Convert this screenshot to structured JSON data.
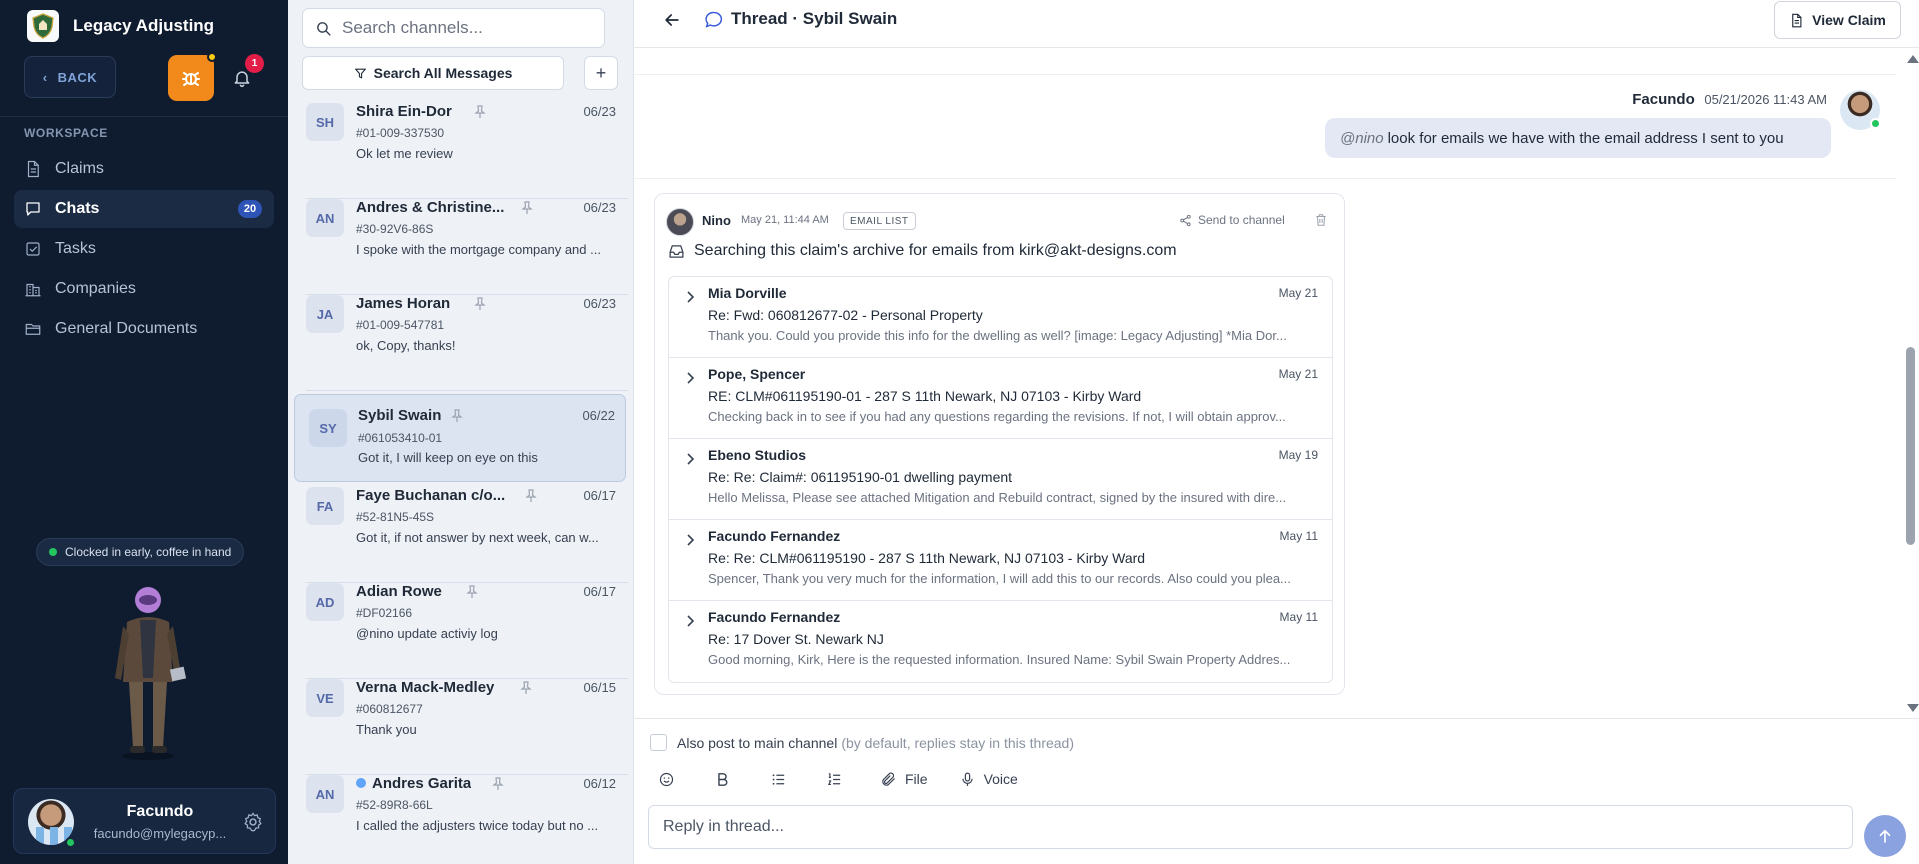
{
  "app": {
    "name": "Legacy Adjusting"
  },
  "sidebar": {
    "back_label": "BACK",
    "notification_count": "1",
    "section_label": "WORKSPACE",
    "items": [
      {
        "label": "Claims",
        "icon": "document-icon"
      },
      {
        "label": "Chats",
        "icon": "chat-icon",
        "badge": "20",
        "active": true
      },
      {
        "label": "Tasks",
        "icon": "checkbox-icon"
      },
      {
        "label": "Companies",
        "icon": "building-icon"
      },
      {
        "label": "General Documents",
        "icon": "folder-icon"
      }
    ],
    "status_text": "Clocked in early, coffee in hand",
    "user": {
      "name": "Facundo",
      "email": "facundo@mylegacyp..."
    }
  },
  "channels": {
    "search_placeholder": "Search channels...",
    "search_all_label": "Search All Messages",
    "add_label": "+",
    "items": [
      {
        "initials": "SH",
        "name": "Shira Ein-Dor",
        "date": "06/23",
        "claim": "#01-009-337530",
        "message": "Ok let me review"
      },
      {
        "initials": "AN",
        "name": "Andres & Christine...",
        "date": "06/23",
        "claim": "#30-92V6-86S",
        "message": "I spoke with the mortgage company and ..."
      },
      {
        "initials": "JA",
        "name": "James Horan",
        "date": "06/23",
        "claim": "#01-009-547781",
        "message": "ok, Copy, thanks!"
      },
      {
        "initials": "SY",
        "name": "Sybil Swain",
        "date": "06/22",
        "claim": "#061053410-01",
        "message": "Got it, I will keep on eye on this",
        "selected": true
      },
      {
        "initials": "FA",
        "name": "Faye Buchanan c/o...",
        "date": "06/17",
        "claim": "#52-81N5-45S",
        "message": "Got it, if not answer by next week, can w..."
      },
      {
        "initials": "AD",
        "name": "Adian Rowe",
        "date": "06/17",
        "claim": "#DF02166",
        "message": "@nino update activiy log"
      },
      {
        "initials": "VE",
        "name": "Verna Mack-Medley",
        "date": "06/15",
        "claim": "#060812677",
        "message": "Thank you"
      },
      {
        "initials": "AN",
        "name": "Andres Garita",
        "date": "06/12",
        "claim": "#52-89R8-66L",
        "message": "I called the adjusters twice today but no ...",
        "unread": true
      }
    ]
  },
  "thread": {
    "title": "Thread · Sybil Swain",
    "view_claim_label": "View Claim",
    "outgoing": {
      "author": "Facundo",
      "timestamp": "05/21/2026 11:43 AM",
      "mention": "@nino",
      "text": "look for emails we have with the email address I sent to you"
    },
    "bot": {
      "author": "Nino",
      "timestamp": "May 21, 11:44 AM",
      "tag": "EMAIL LIST",
      "send_label": "Send to channel",
      "headline": "Searching this claim's archive for emails from kirk@akt-designs.com",
      "emails": [
        {
          "from": "Mia Dorville",
          "date": "May 21",
          "subject": "Re: Fwd: 060812677-02 - Personal Property",
          "preview": "Thank you. Could you provide this info for the dwelling as well? [image: Legacy Adjusting] *Mia Dor..."
        },
        {
          "from": "Pope, Spencer",
          "date": "May 21",
          "subject": "RE: CLM#061195190-01 - 287 S 11th Newark, NJ 07103 - Kirby Ward",
          "preview": "Checking back in to see if you had any questions regarding the revisions. If not, I will obtain approv..."
        },
        {
          "from": "Ebeno Studios",
          "date": "May 19",
          "subject": "Re: Re: Claim#: 061195190-01 dwelling payment",
          "preview": "Hello Melissa, Please see attached Mitigation and Rebuild contract, signed by the insured with dire..."
        },
        {
          "from": "Facundo Fernandez",
          "date": "May 11",
          "subject": "Re: Re: CLM#061195190 - 287 S 11th Newark, NJ 07103 - Kirby Ward",
          "preview": "Spencer, Thank you very much for the information, I will add this to our records. Also could you plea..."
        },
        {
          "from": "Facundo Fernandez",
          "date": "May 11",
          "subject": "Re: 17 Dover St. Newark NJ",
          "preview": "Good morning, Kirk, Here is the requested information. Insured Name: Sybil Swain Property Addres..."
        }
      ]
    },
    "composer": {
      "also_post_label": "Also post to main channel",
      "also_post_hint": "(by default, replies stay in this thread)",
      "file_label": "File",
      "voice_label": "Voice",
      "reply_placeholder": "Reply in thread..."
    }
  }
}
